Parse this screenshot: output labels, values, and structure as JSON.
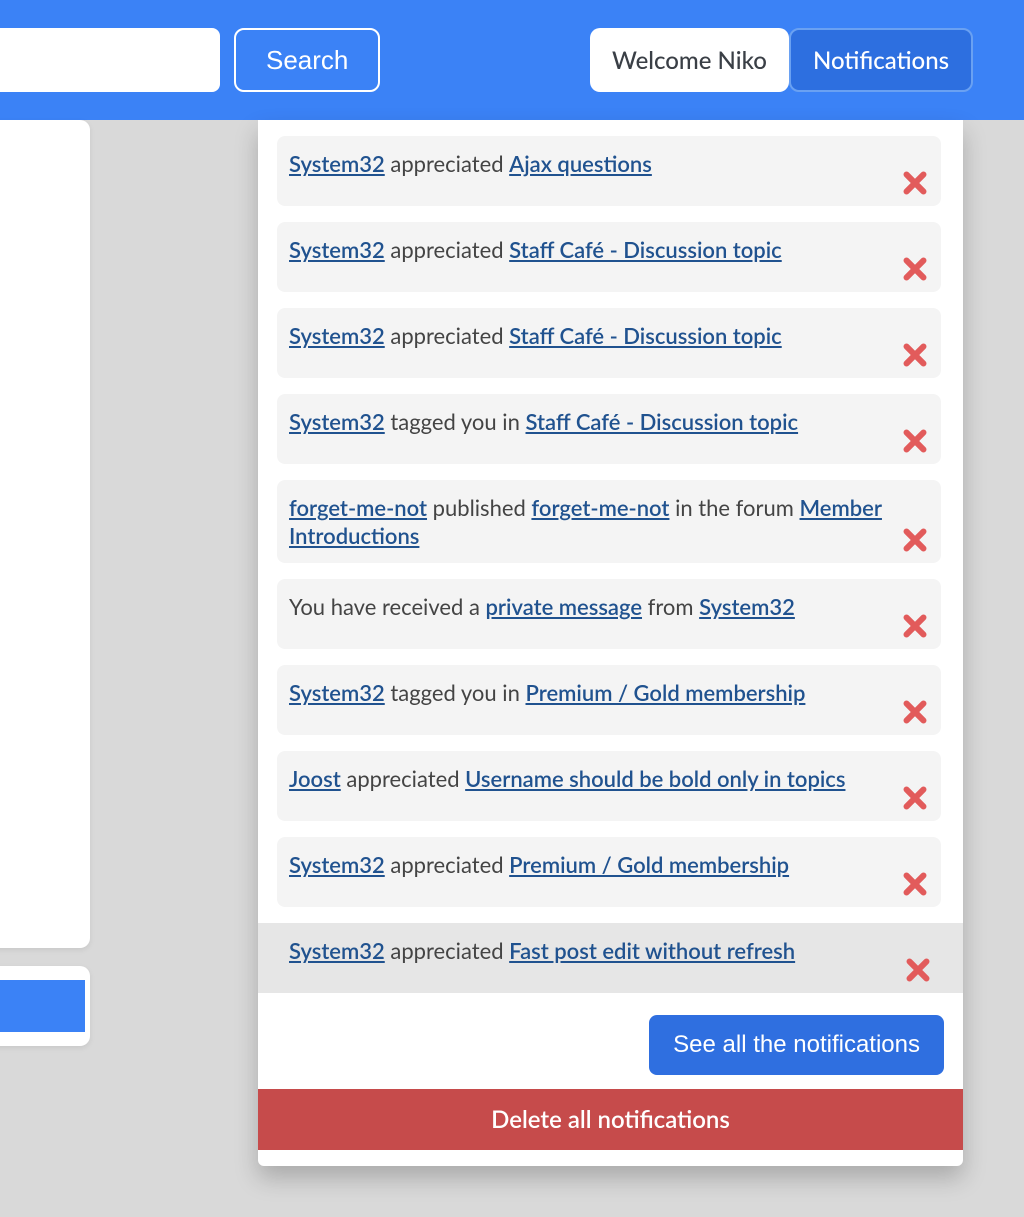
{
  "header": {
    "search_placeholder": "",
    "search_button": "Search",
    "welcome_label": "Welcome Niko",
    "notifications_button": "Notifications"
  },
  "notifications": {
    "see_all_label": "See all the notifications",
    "delete_all_label": "Delete all notifications",
    "items": [
      {
        "actor": "System32",
        "verb": " appreciated ",
        "target": "Ajax questions"
      },
      {
        "actor": "System32",
        "verb": " appreciated ",
        "target": "Staff Café - Discussion topic"
      },
      {
        "actor": "System32",
        "verb": " appreciated ",
        "target": "Staff Café - Discussion topic"
      },
      {
        "actor": "System32",
        "verb": " tagged you in ",
        "target": "Staff Café - Discussion topic"
      },
      {
        "actor": "forget-me-not",
        "verb": " published ",
        "target": "forget-me-not",
        "suffix": " in the forum ",
        "target2": "Member Introductions"
      },
      {
        "prefix": "You have received a ",
        "target": "private message",
        "suffix": " from ",
        "actor": "System32"
      },
      {
        "actor": "System32",
        "verb": " tagged you in ",
        "target": "Premium / Gold membership"
      },
      {
        "actor": "Joost",
        "verb": " appreciated ",
        "target": "Username should be bold only in topics"
      },
      {
        "actor": "System32",
        "verb": " appreciated ",
        "target": "Premium / Gold membership"
      },
      {
        "actor": "System32",
        "verb": " appreciated ",
        "target": "Fast post edit without refresh"
      }
    ]
  },
  "colors": {
    "topbar": "#3b82f6",
    "link": "#20528f",
    "row_bg": "#f4f4f4",
    "row_highlight_bg": "#e6e6e6",
    "close_icon": "#e25b5b",
    "see_all_button": "#2f6fe0",
    "delete_all_button": "#c64b4b"
  }
}
